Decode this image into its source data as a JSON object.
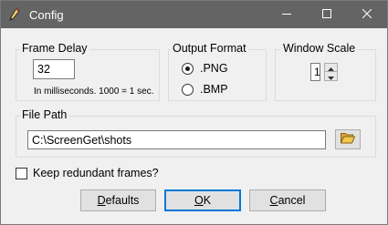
{
  "window": {
    "title": "Config",
    "app_icon": "pencil-icon",
    "controls": {
      "minimize": "minimize-icon",
      "maximize": "maximize-icon",
      "close": "close-icon"
    }
  },
  "frame_delay": {
    "label": "Frame Delay",
    "value": "32",
    "hint": "In milliseconds. 1000 = 1 sec."
  },
  "output_format": {
    "label": "Output Format",
    "options": [
      {
        "label": ".PNG",
        "checked": true
      },
      {
        "label": ".BMP",
        "checked": false
      }
    ]
  },
  "window_scale": {
    "label": "Window Scale",
    "value": "1"
  },
  "file_path": {
    "label": "File Path",
    "value": "C:\\ScreenGet\\shots",
    "browse_icon": "folder-open-icon"
  },
  "keep_redundant": {
    "label": "Keep redundant frames?",
    "checked": false
  },
  "buttons": {
    "defaults": {
      "pre": "",
      "mnemonic": "D",
      "post": "efaults"
    },
    "ok": {
      "pre": "",
      "mnemonic": "O",
      "post": "K"
    },
    "cancel": {
      "pre": "",
      "mnemonic": "C",
      "post": "ancel"
    }
  },
  "colors": {
    "titlebar": "#646464",
    "background": "#f0f0f0",
    "default_button_border": "#0078d7"
  }
}
